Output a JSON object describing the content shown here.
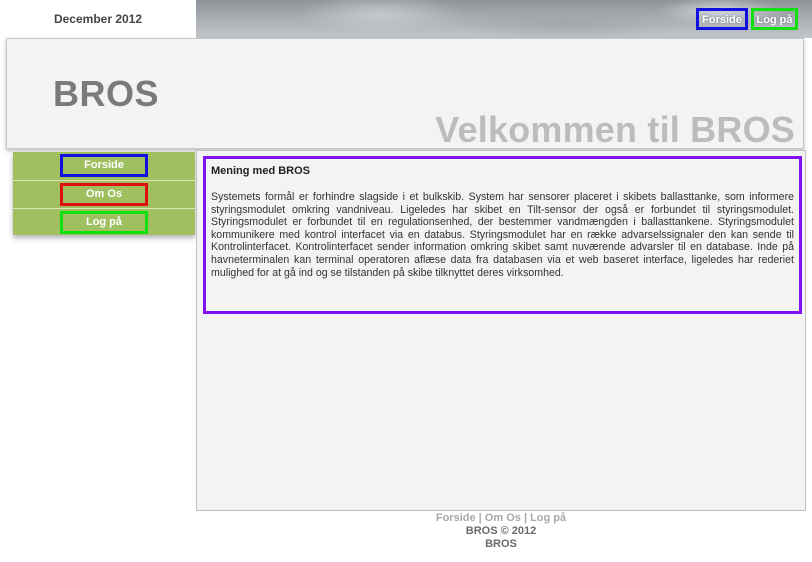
{
  "header": {
    "date": "December 2012",
    "top_links": {
      "forside": "Forside",
      "log_paa": "Log på"
    },
    "logo": "BROS",
    "welcome": "Velkommen til BROS"
  },
  "nav": {
    "items": [
      {
        "label": "Forside"
      },
      {
        "label": "Om Os"
      },
      {
        "label": "Log på"
      }
    ]
  },
  "article": {
    "title": "Mening med BROS",
    "body": "Systemets formål er forhindre slagside i et bulkskib. System har sensorer placeret i skibets ballasttanke, som informere styringsmodulet omkring vandniveau. Ligeledes har skibet en Tilt-sensor der også er forbundet til styringsmodulet. Styringsmodulet er forbundet til en regulationsenhed, der bestemmer vandmængden i ballasttankene. Styringsmodulet kommunikere med kontrol interfacet via en databus. Styringsmodulet har en række advarselssignaler den kan sende til Kontrolinterfacet. Kontrolinterfacet sender information omkring skibet samt nuværende advarsler til en database. Inde på havneterminalen kan terminal operatoren aflæse data fra databasen via et web baseret interface, ligeledes har rederiet mulighed for at gå ind og se tilstanden på skibe tilknyttet deres virksomhed."
  },
  "footer": {
    "links": {
      "forside": "Forside",
      "om_os": "Om Os",
      "log_paa": "Log på"
    },
    "separator": "|",
    "copyright": "BROS © 2012",
    "name": "BROS"
  },
  "colors": {
    "nav_green": "#a0c060",
    "highlight_blue": "#1010e0",
    "highlight_green": "#10e010",
    "highlight_red": "#e01010",
    "highlight_purple": "#8010f0"
  }
}
